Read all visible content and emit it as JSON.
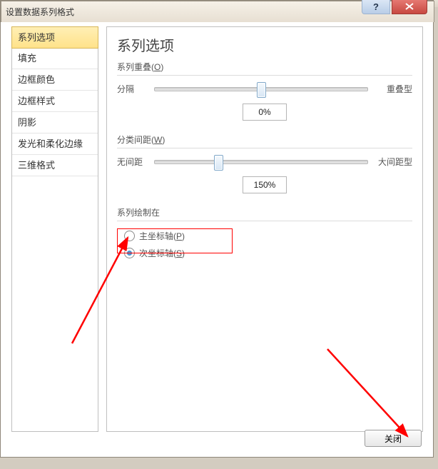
{
  "window": {
    "title": "设置数据系列格式"
  },
  "sidebar": {
    "items": [
      "系列选项",
      "填充",
      "边框颜色",
      "边框样式",
      "阴影",
      "发光和柔化边缘",
      "三维格式"
    ],
    "selected_index": 0
  },
  "panel": {
    "heading": "系列选项",
    "overlap": {
      "title": "系列重叠",
      "accel": "O",
      "left": "分隔",
      "right": "重叠型",
      "value": "0%",
      "slider_position_pct": 50
    },
    "gap": {
      "title": "分类间距",
      "accel": "W",
      "left": "无间距",
      "right": "大间距型",
      "value": "150%",
      "slider_position_pct": 30
    },
    "ploton": {
      "title": "系列绘制在",
      "primary": {
        "label": "主坐标轴",
        "accel": "P",
        "checked": false
      },
      "secondary": {
        "label": "次坐标轴",
        "accel": "S",
        "checked": true
      }
    }
  },
  "footer": {
    "close": "关闭"
  }
}
